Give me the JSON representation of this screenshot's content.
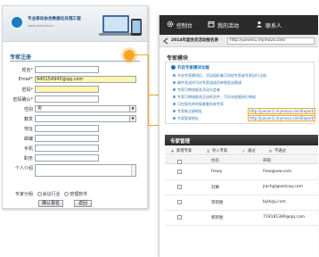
{
  "left_form": {
    "banner": {
      "title": "专业移动协会数据化处理工程",
      "subtitle": "www.jiemima.cn"
    },
    "title": "专家注册",
    "fields": [
      {
        "label": "姓名",
        "required": true,
        "value": ""
      },
      {
        "label": "Email",
        "required": true,
        "value": "940154945@qq.com"
      },
      {
        "label": "密码",
        "required": true,
        "value": ""
      },
      {
        "label": "密码确认",
        "required": true,
        "value": ""
      },
      {
        "label": "性别",
        "required": false,
        "value": "男"
      },
      {
        "label": "籍贯",
        "required": false,
        "value": ""
      },
      {
        "label": "地址",
        "required": false,
        "value": ""
      },
      {
        "label": "邮编",
        "required": false,
        "value": ""
      },
      {
        "label": "手机",
        "required": false,
        "value": ""
      },
      {
        "label": "职务",
        "required": false,
        "value": ""
      },
      {
        "label": "个人介绍",
        "required": false,
        "value": ""
      }
    ],
    "group_label": "专家分组",
    "group_options": [
      "会议行业",
      "管理软件"
    ],
    "confirm_button": "确认报名",
    "back_button": "返回"
  },
  "right_panel": {
    "nav": {
      "items": [
        "控制台",
        "我的活动",
        "联系人"
      ]
    },
    "tab_title": "2014年度会员活动报名表",
    "url": "http://jueven1.mymova.com/",
    "module_title": "专家模块",
    "info": {
      "heading": "开启专家模块功能",
      "tips": [
        "开启专家模块后，活动组织者可添加专家或专家自行注册",
        "邮件发送时可对专家组成员单独发送邀请",
        "专家可审核报名活动与会者",
        "专家可审核报名活动的文件，可开启权限进行审核",
        "可在报名的时候查看所有专家",
        "专家新注册地址",
        "专家登录地址"
      ],
      "register_url": "http://jueven1.mymova.com/Expert/Register",
      "login_url": "http://jueven1.mymova.com/Expert/login"
    },
    "mgmt": {
      "title": "专家管理",
      "toolbar": [
        "新增专家",
        "导入专家",
        "通过",
        "不通过"
      ],
      "columns": [
        "",
        "姓名",
        "邮箱"
      ],
      "rows": [
        {
          "name": "frewy",
          "email": "frew@ww.com"
        },
        {
          "name": "刘琳",
          "email": "jiachgl@wdcaq.com"
        },
        {
          "name": "李新胜",
          "email": "bjzk@j.com"
        },
        {
          "name": "郭新胜",
          "email": "719181389@qq.com"
        }
      ]
    }
  }
}
